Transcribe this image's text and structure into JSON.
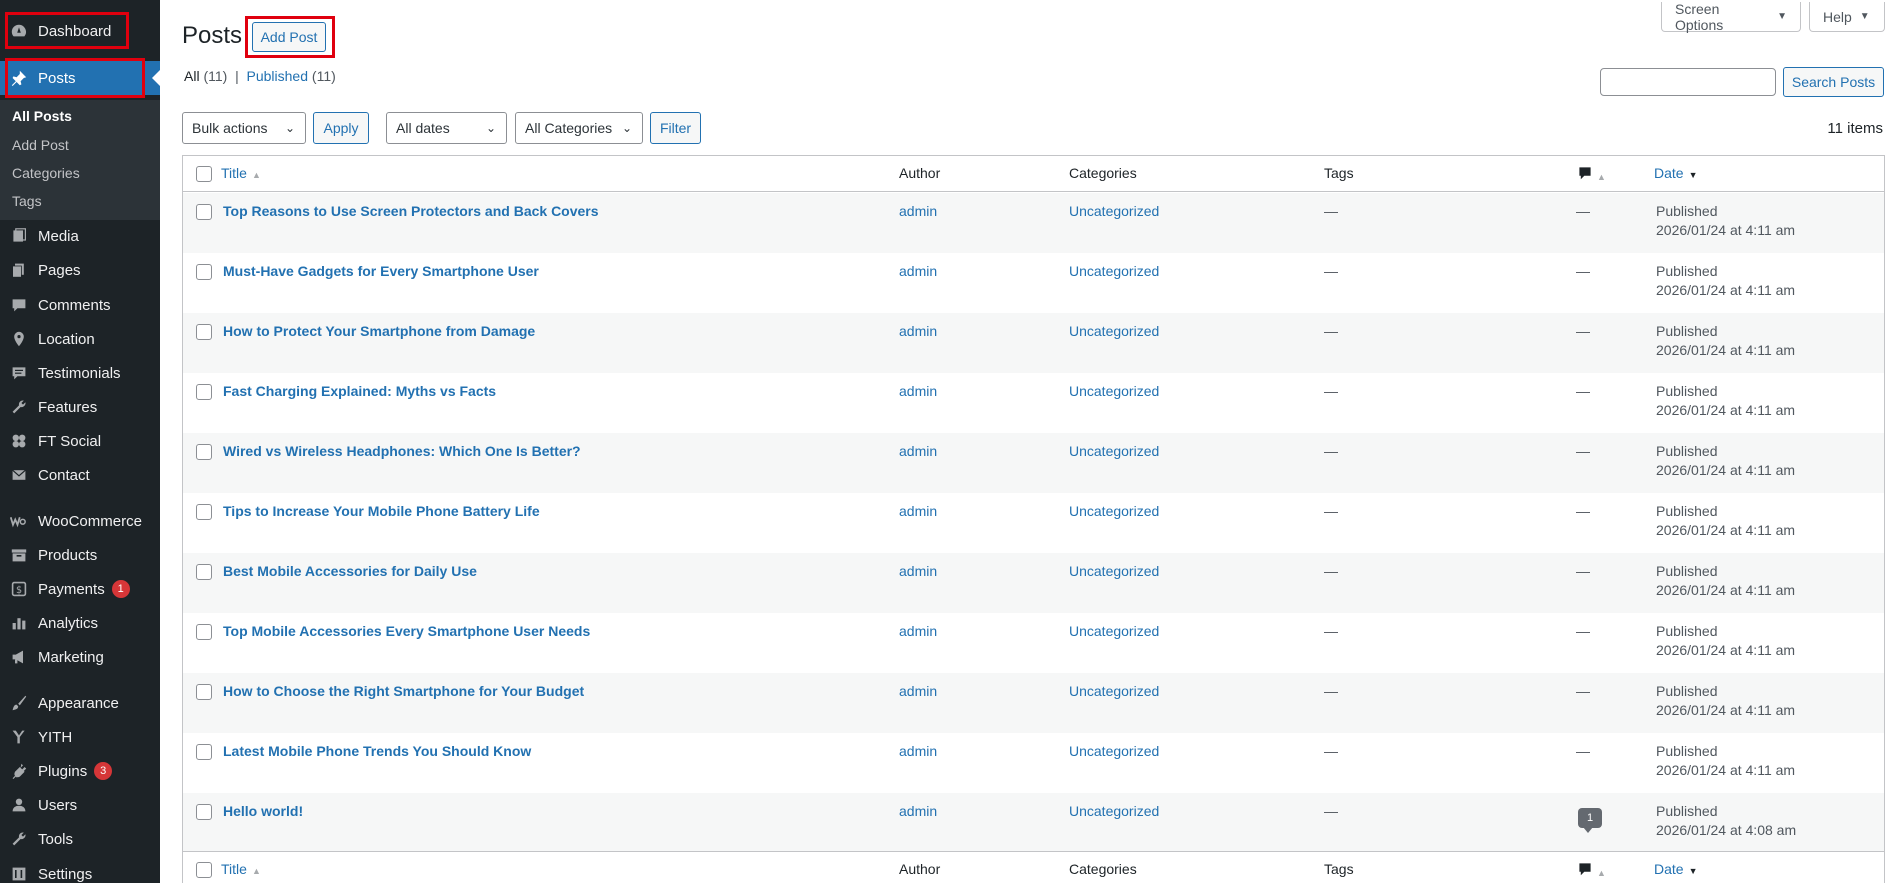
{
  "sidebar": {
    "items": [
      {
        "label": "Dashboard",
        "icon": "dashboard-icon"
      },
      {
        "label": "Posts",
        "icon": "pin-icon"
      },
      {
        "label": "Media",
        "icon": "media-icon"
      },
      {
        "label": "Pages",
        "icon": "pages-icon"
      },
      {
        "label": "Comments",
        "icon": "comments-icon"
      },
      {
        "label": "Location",
        "icon": "location-icon"
      },
      {
        "label": "Testimonials",
        "icon": "testimonials-icon"
      },
      {
        "label": "Features",
        "icon": "wrench-icon"
      },
      {
        "label": "FT Social",
        "icon": "social-icon"
      },
      {
        "label": "Contact",
        "icon": "mail-icon"
      },
      {
        "label": "WooCommerce",
        "icon": "woocommerce-icon"
      },
      {
        "label": "Products",
        "icon": "archive-icon"
      },
      {
        "label": "Payments",
        "icon": "dollar-icon",
        "badge": "1"
      },
      {
        "label": "Analytics",
        "icon": "bar-chart-icon"
      },
      {
        "label": "Marketing",
        "icon": "megaphone-icon"
      },
      {
        "label": "Appearance",
        "icon": "brush-icon"
      },
      {
        "label": "YITH",
        "icon": "yith-icon"
      },
      {
        "label": "Plugins",
        "icon": "plugin-icon",
        "badge": "3"
      },
      {
        "label": "Users",
        "icon": "user-icon"
      },
      {
        "label": "Tools",
        "icon": "tools-icon"
      },
      {
        "label": "Settings",
        "icon": "settings-icon"
      }
    ],
    "submenu": [
      "All Posts",
      "Add Post",
      "Categories",
      "Tags"
    ]
  },
  "header": {
    "title": "Posts",
    "add_post": "Add Post",
    "screen_options": "Screen Options",
    "help": "Help"
  },
  "views": {
    "all_label": "All",
    "all_count": "(11)",
    "separator": "|",
    "published_label": "Published",
    "published_count": "(11)"
  },
  "search": {
    "value": "",
    "button": "Search Posts"
  },
  "filters": {
    "bulk_actions": "Bulk actions",
    "apply": "Apply",
    "dates": "All dates",
    "categories": "All Categories",
    "filter": "Filter",
    "items_count": "11 items"
  },
  "table": {
    "columns": {
      "title": "Title",
      "author": "Author",
      "categories": "Categories",
      "tags": "Tags",
      "date": "Date"
    },
    "rows": [
      {
        "title": "Top Reasons to Use Screen Protectors and Back Covers",
        "author": "admin",
        "categories": "Uncategorized",
        "tags": "—",
        "comments": "—",
        "status": "Published",
        "date": "2026/01/24 at 4:11 am"
      },
      {
        "title": "Must-Have Gadgets for Every Smartphone User",
        "author": "admin",
        "categories": "Uncategorized",
        "tags": "—",
        "comments": "—",
        "status": "Published",
        "date": "2026/01/24 at 4:11 am"
      },
      {
        "title": "How to Protect Your Smartphone from Damage",
        "author": "admin",
        "categories": "Uncategorized",
        "tags": "—",
        "comments": "—",
        "status": "Published",
        "date": "2026/01/24 at 4:11 am"
      },
      {
        "title": "Fast Charging Explained: Myths vs Facts",
        "author": "admin",
        "categories": "Uncategorized",
        "tags": "—",
        "comments": "—",
        "status": "Published",
        "date": "2026/01/24 at 4:11 am"
      },
      {
        "title": "Wired vs Wireless Headphones: Which One Is Better?",
        "author": "admin",
        "categories": "Uncategorized",
        "tags": "—",
        "comments": "—",
        "status": "Published",
        "date": "2026/01/24 at 4:11 am"
      },
      {
        "title": "Tips to Increase Your Mobile Phone Battery Life",
        "author": "admin",
        "categories": "Uncategorized",
        "tags": "—",
        "comments": "—",
        "status": "Published",
        "date": "2026/01/24 at 4:11 am"
      },
      {
        "title": "Best Mobile Accessories for Daily Use",
        "author": "admin",
        "categories": "Uncategorized",
        "tags": "—",
        "comments": "—",
        "status": "Published",
        "date": "2026/01/24 at 4:11 am"
      },
      {
        "title": "Top Mobile Accessories Every Smartphone User Needs",
        "author": "admin",
        "categories": "Uncategorized",
        "tags": "—",
        "comments": "—",
        "status": "Published",
        "date": "2026/01/24 at 4:11 am"
      },
      {
        "title": "How to Choose the Right Smartphone for Your Budget",
        "author": "admin",
        "categories": "Uncategorized",
        "tags": "—",
        "comments": "—",
        "status": "Published",
        "date": "2026/01/24 at 4:11 am"
      },
      {
        "title": "Latest Mobile Phone Trends You Should Know",
        "author": "admin",
        "categories": "Uncategorized",
        "tags": "—",
        "comments": "—",
        "status": "Published",
        "date": "2026/01/24 at 4:11 am"
      },
      {
        "title": "Hello world!",
        "author": "admin",
        "categories": "Uncategorized",
        "tags": "—",
        "comments": "1",
        "status": "Published",
        "date": "2026/01/24 at 4:08 am"
      }
    ]
  },
  "colors": {
    "sidebar_bg": "#1d2327",
    "accent": "#2271b1",
    "highlight_box": "#e0000e",
    "badge": "#d63638"
  }
}
